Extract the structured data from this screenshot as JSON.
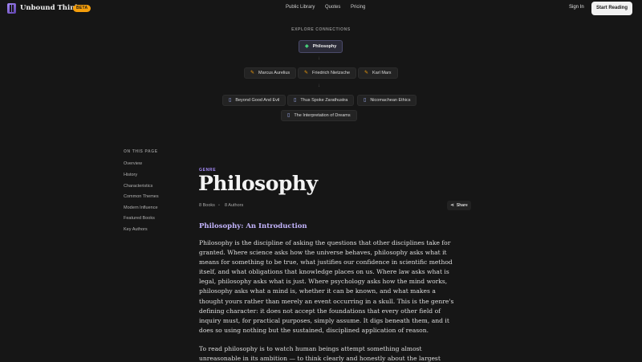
{
  "header": {
    "brand": "Unbound Thinker",
    "badge": "BETA",
    "nav": [
      "Public Library",
      "Quotes",
      "Pricing"
    ],
    "sign_in": "Sign In",
    "cta": "Start Reading"
  },
  "explore": {
    "title": "EXPLORE CONNECTIONS",
    "root": "Philosophy",
    "arrow": "↓",
    "authors": [
      "Marcus Aurelius",
      "Friedrich Nietzsche",
      "Karl Marx"
    ],
    "books": [
      "Beyond Good And Evil",
      "Thus Spoke Zarathustra",
      "Nicomachean Ethics",
      "The Interpretation of Dreams"
    ]
  },
  "toc": {
    "title": "ON THIS PAGE",
    "items": [
      "Overview",
      "History",
      "Characteristics",
      "Common Themes",
      "Modern Influence",
      "Featured Books",
      "Key Authors"
    ]
  },
  "main": {
    "label": "GENRE",
    "title": "Philosophy",
    "books_count": "8 Books",
    "separator": "•",
    "authors_count": "8 Authors",
    "share": "Share",
    "section_heading": "Philosophy: An Introduction",
    "paragraph_1": "Philosophy is the discipline of asking the questions that other disciplines take for granted. Where science asks how the universe behaves, philosophy asks what it means for something to be true, what justifies our confidence in scientific method itself, and what obligations that knowledge places on us. Where law asks what is legal, philosophy asks what is just. Where psychology asks how the mind works, philosophy asks what a mind is, whether it can be known, and what makes a thought yours rather than merely an event occurring in a skull. This is the genre's defining character: it does not accept the foundations that every other field of inquiry must, for practical purposes, simply assume. It digs beneath them, and it does so using nothing but the sustained, disciplined application of reason.",
    "paragraph_2": "To read philosophy is to watch human beings attempt something almost unreasonable in its ambition — to think clearly and honestly about the largest questions there are,"
  },
  "icons": {
    "root": "tag-icon",
    "author": "quill-icon",
    "book": "book-icon",
    "share": "share-icon"
  },
  "colors": {
    "accent": "#a78bfa",
    "heading_accent": "#c4b5fd",
    "badge": "#f59e0b",
    "background": "#161616"
  }
}
